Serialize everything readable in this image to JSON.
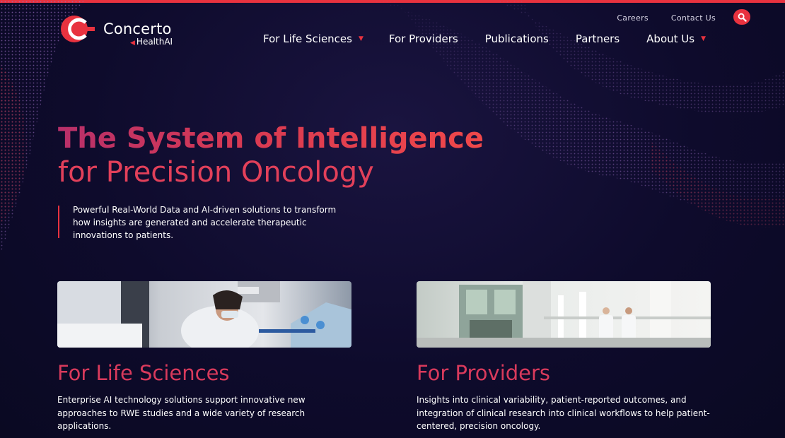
{
  "brand": {
    "name": "Concerto",
    "sub": "HealthAI",
    "accent": "#e8323f",
    "background": "#0c0a26"
  },
  "utility_nav": {
    "careers": "Careers",
    "contact": "Contact Us",
    "search_icon": "search-icon"
  },
  "main_nav": {
    "items": [
      {
        "label": "For Life Sciences",
        "has_dropdown": true
      },
      {
        "label": "For Providers",
        "has_dropdown": false
      },
      {
        "label": "Publications",
        "has_dropdown": false
      },
      {
        "label": "Partners",
        "has_dropdown": false
      },
      {
        "label": "About Us",
        "has_dropdown": true
      }
    ]
  },
  "hero": {
    "title": "The System of Intelligence",
    "subtitle": "for Precision Oncology",
    "description": "Powerful Real-World Data and AI-driven solutions to transform how insights are generated and accelerate therapeutic innovations to patients."
  },
  "cards": [
    {
      "title": "For Life Sciences",
      "description": "Enterprise AI technology solutions support innovative new approaches to RWE studies and a wide variety of research applications.",
      "image": "lab-researchers-photo"
    },
    {
      "title": "For Providers",
      "description": "Insights into clinical variability, patient-reported outcomes, and integration of clinical research into clinical workflows to help patient-centered, precision oncology.",
      "image": "hospital-corridor-photo"
    }
  ]
}
